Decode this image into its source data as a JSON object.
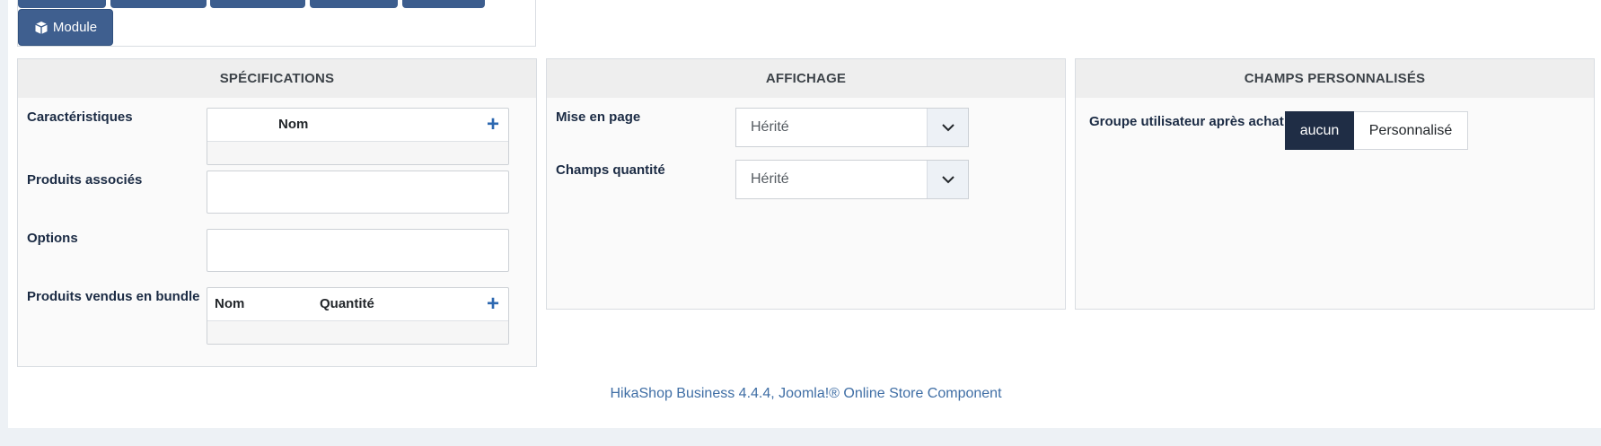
{
  "top": {
    "module_button_label": "Module"
  },
  "specifications": {
    "title": "SPÉCIFICATIONS",
    "characteristics_label": "Caractéristiques",
    "characteristics_col_name": "Nom",
    "associated_products_label": "Produits associés",
    "options_label": "Options",
    "bundle_label": "Produits vendus en bundle",
    "bundle_col_name": "Nom",
    "bundle_col_quantity": "Quantité"
  },
  "display": {
    "title": "AFFICHAGE",
    "layout_label": "Mise en page",
    "layout_value": "Hérité",
    "quantity_label": "Champs quantité",
    "quantity_value": "Hérité"
  },
  "custom_fields": {
    "title": "CHAMPS PERSONNALISÉS",
    "user_group_label": "Groupe utilisateur après achat",
    "option_none": "aucun",
    "option_custom": "Personnalisé",
    "selected": "aucun"
  },
  "footer": {
    "text": "HikaShop Business 4.4.4, Joomla!® Online Store Component"
  },
  "colors": {
    "primary_button": "#3f5f8f",
    "toggle_active": "#1f2d45",
    "link": "#3f6ea5",
    "plus_icon": "#2d68b0"
  }
}
